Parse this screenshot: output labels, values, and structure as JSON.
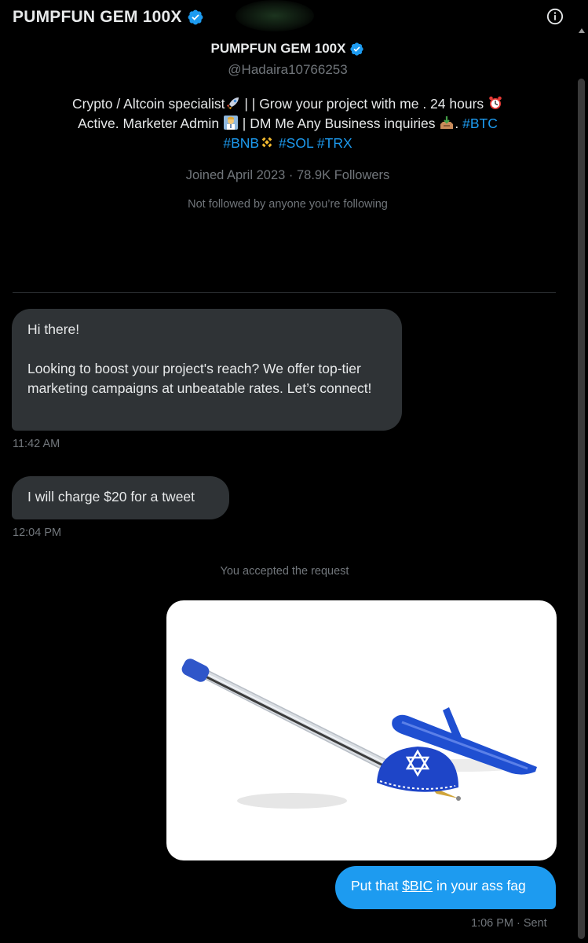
{
  "header": {
    "title": "PUMPFUN GEM 100X",
    "verified_icon": "verified-badge-icon",
    "info_icon": "info-icon"
  },
  "profile": {
    "name": "PUMPFUN GEM 100X",
    "handle": "@Hadaira10766253",
    "bio_line1_text": "Crypto / Altcoin specialist",
    "bio_line1_sep": " | | Grow your project with me . 24 hours ",
    "bio_line2_a": "Active. Marketer Admin ",
    "bio_line2_b": " | DM Me Any Business inquiries ",
    "bio_line2_dot": ". ",
    "tag_btc": "#BTC",
    "tag_bnb": "#BNB",
    "tag_sol": "#SOL",
    "tag_trx": "#TRX",
    "joined": "Joined April 2023",
    "sep": " · ",
    "followers": "78.9K Followers",
    "not_followed": "Not followed by anyone you’re following"
  },
  "messages": {
    "m1_line1": "Hi there!",
    "m1_body": "Looking to boost your project's reach? We offer top-tier marketing campaigns at unbeatable rates. Let’s connect!",
    "m1_time": "11:42 AM",
    "m2_text": "I will charge $20 for a tweet",
    "m2_time": "12:04 PM",
    "system": "You accepted the request",
    "out_pre": "Put that ",
    "out_cashtag": "$BIC",
    "out_post": " in your ass fag",
    "out_time": "1:06 PM · Sent"
  },
  "colors": {
    "accent": "#1d9bf0",
    "bubble_in": "#2f3336",
    "muted": "#71767b",
    "background": "#000000"
  }
}
